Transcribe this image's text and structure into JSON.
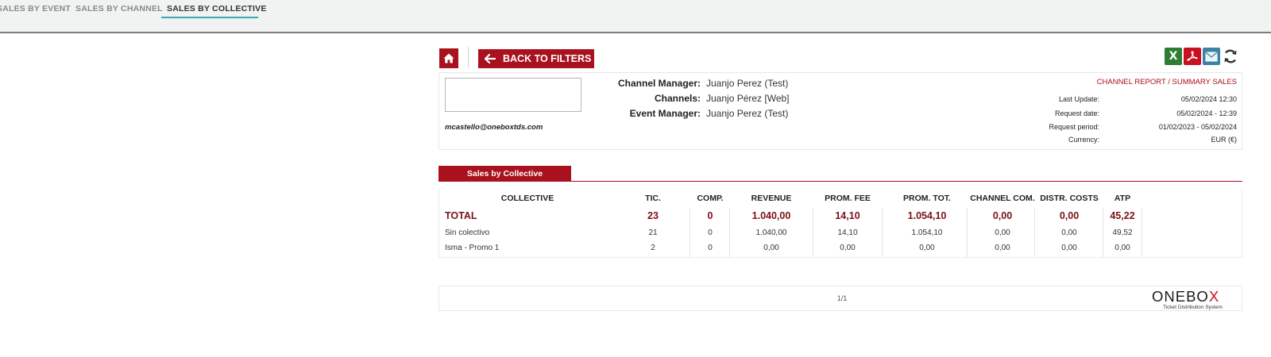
{
  "tabs": [
    {
      "label": "SALES BY EVENT",
      "active": false
    },
    {
      "label": "SALES BY CHANNEL",
      "active": false
    },
    {
      "label": "SALES BY COLLECTIVE",
      "active": true
    }
  ],
  "toolbar": {
    "home_icon": "home-icon",
    "back_label": "BACK TO FILTERS",
    "exports": [
      "excel-icon",
      "pdf-icon",
      "email-icon",
      "refresh-icon"
    ],
    "excel_glyph": "X"
  },
  "header": {
    "email": "mcastello@oneboxtds.com",
    "fields": [
      {
        "label": "Channel Manager:",
        "value": "Juanjo Perez (Test)"
      },
      {
        "label": "Channels:",
        "value": "Juanjo Pérez [Web]"
      },
      {
        "label": "Event Manager:",
        "value": "Juanjo Perez (Test)"
      }
    ],
    "report_title": "CHANNEL REPORT / SUMMARY SALES",
    "meta": [
      {
        "label": "Last Update:",
        "value": "05/02/2024 12:30"
      },
      {
        "label": "Request date:",
        "value": "05/02/2024 - 12:39"
      },
      {
        "label": "Request period:",
        "value": "01/02/2023 - 05/02/2024"
      },
      {
        "label": "Currency:",
        "value": "EUR (€)"
      }
    ]
  },
  "section": {
    "title": "Sales by Collective"
  },
  "table": {
    "columns": [
      "COLLECTIVE",
      "TIC.",
      "COMP.",
      "REVENUE",
      "PROM. FEE",
      "PROM. TOT.",
      "CHANNEL COM.",
      "DISTR. COSTS",
      "ATP"
    ],
    "total": [
      "TOTAL",
      "23",
      "0",
      "1.040,00",
      "14,10",
      "1.054,10",
      "0,00",
      "0,00",
      "45,22"
    ],
    "rows": [
      [
        "Sin colectivo",
        "21",
        "0",
        "1.040,00",
        "14,10",
        "1.054,10",
        "0,00",
        "0,00",
        "49,52"
      ],
      [
        "Isma - Promo 1",
        "2",
        "0",
        "0,00",
        "0,00",
        "0,00",
        "0,00",
        "0,00",
        "0,00"
      ]
    ]
  },
  "footer": {
    "pager": "1/1",
    "brand_main": "ONEBO",
    "brand_x": "X",
    "brand_sub": "Ticket Distribution System"
  },
  "colors": {
    "accent": "#a8111d",
    "tab_underline": "#3aa7b5",
    "total_text": "#7a1117"
  }
}
